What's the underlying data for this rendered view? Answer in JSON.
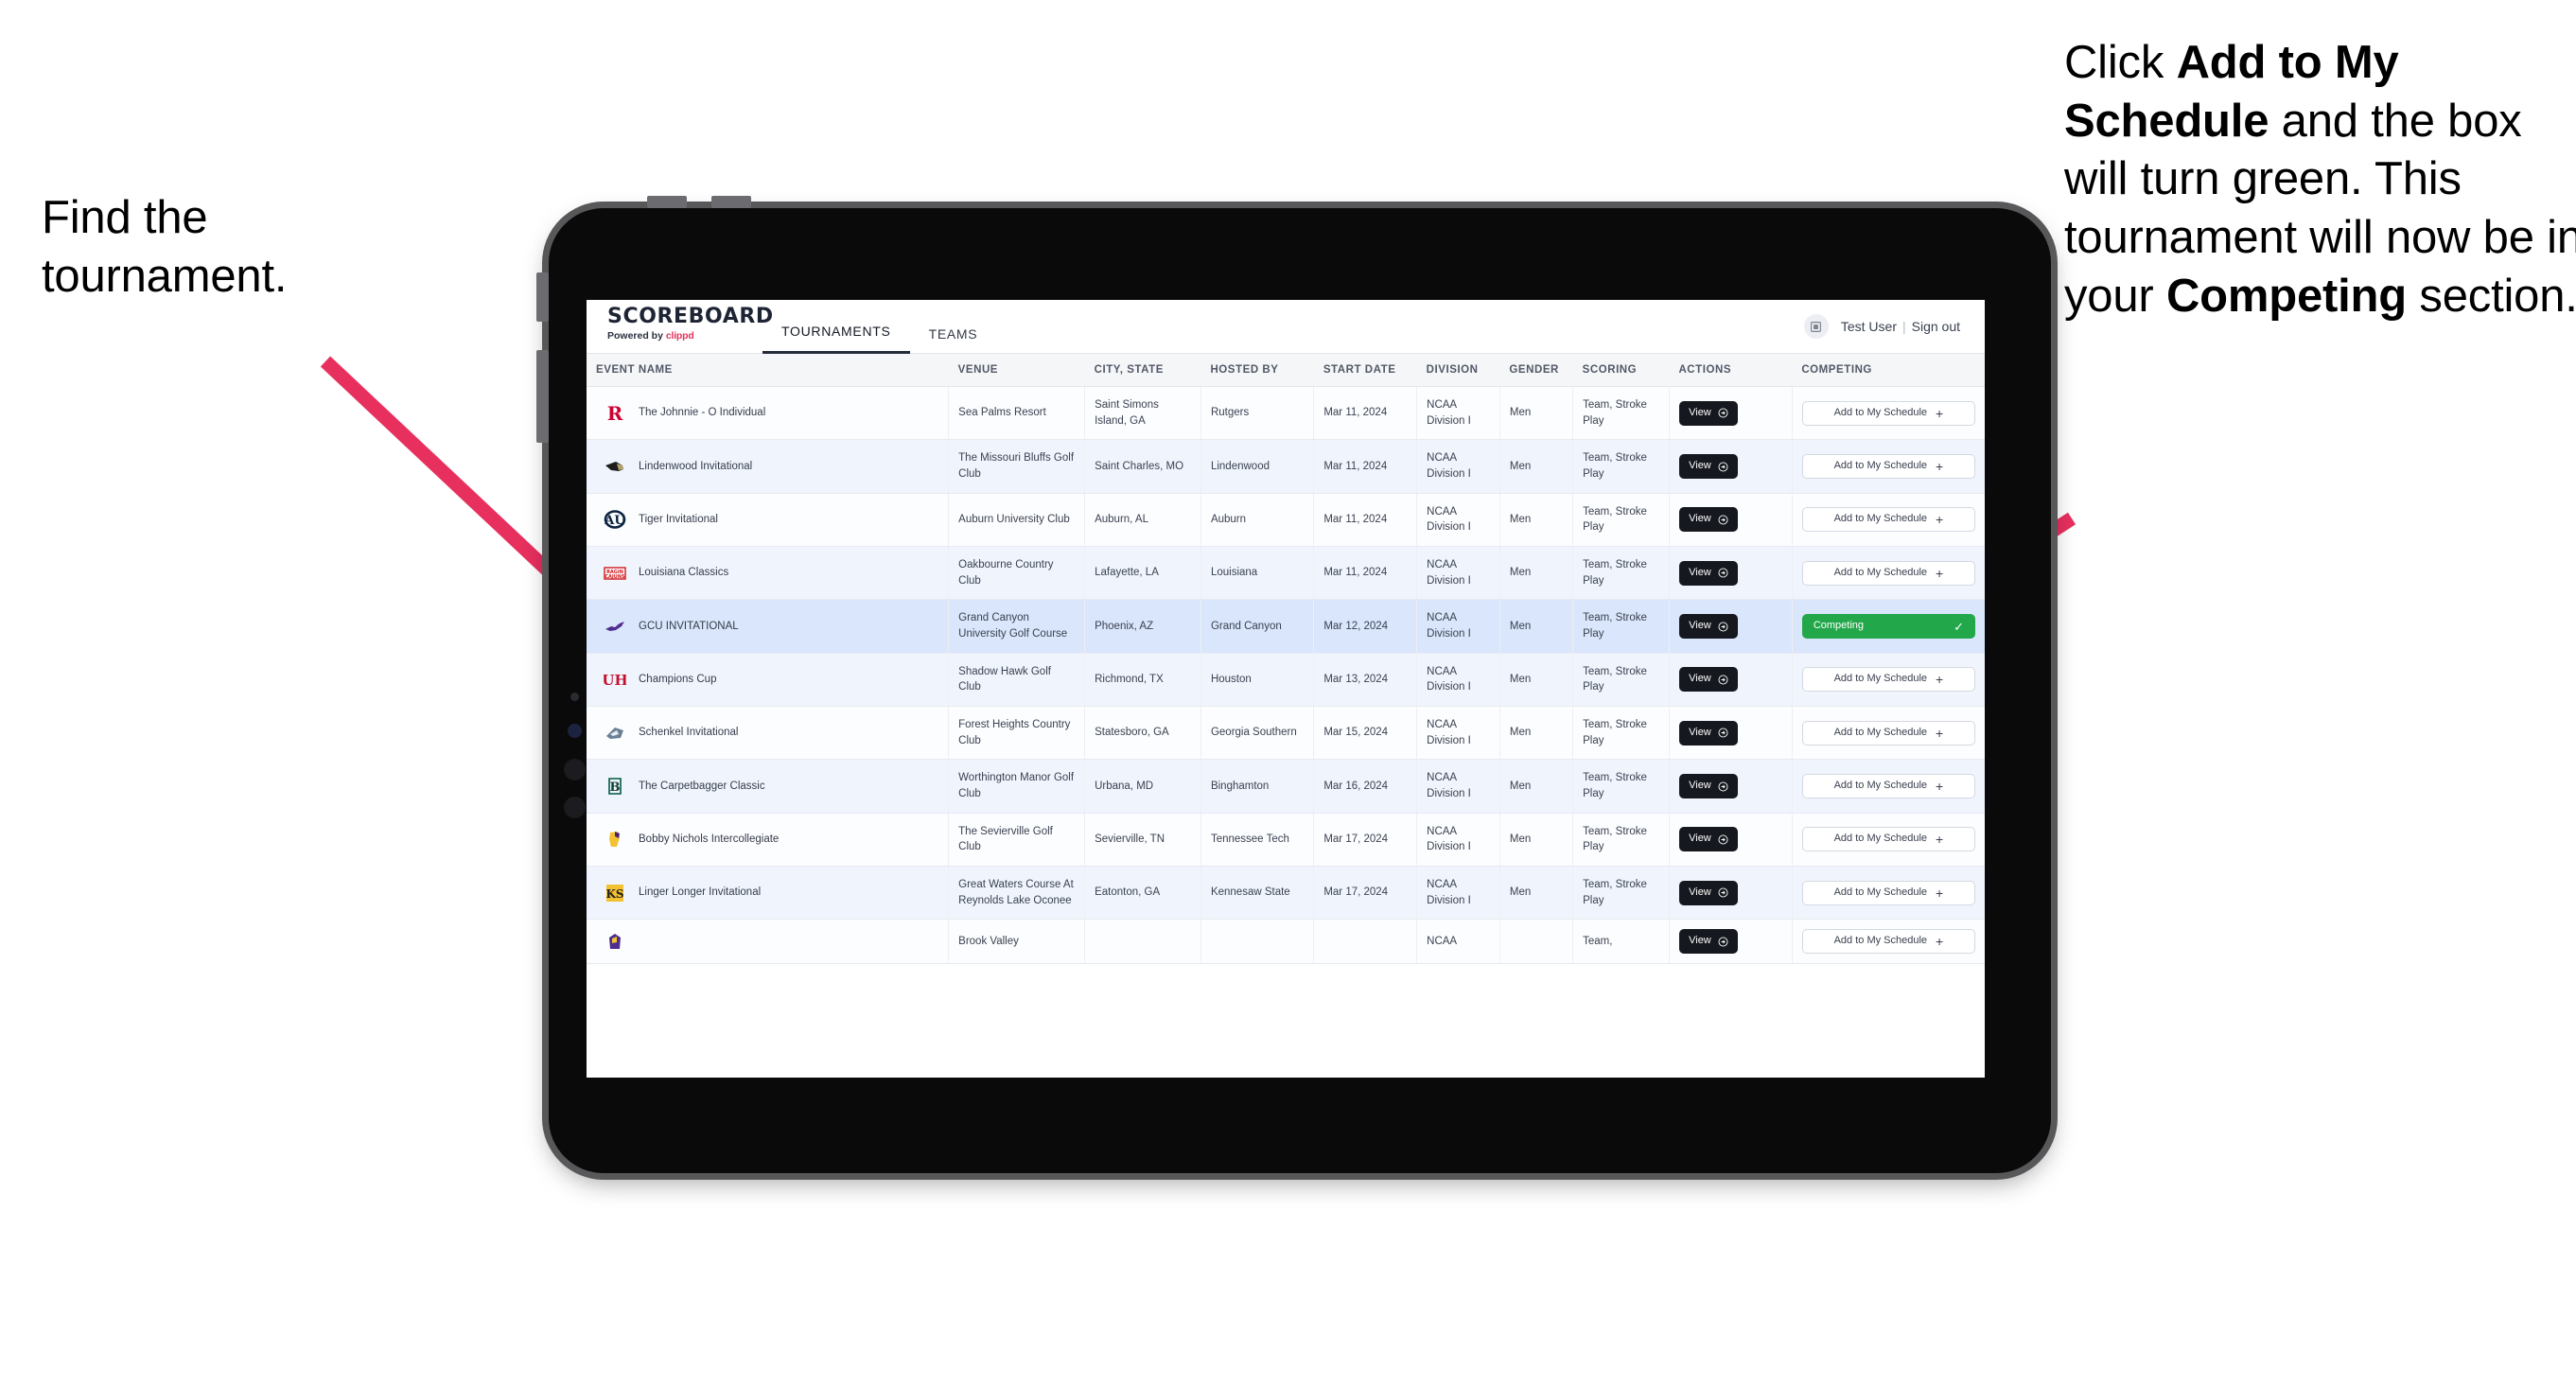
{
  "annotations": {
    "left": {
      "line1": "Find the",
      "line2": "tournament."
    },
    "right": {
      "p1": "Click ",
      "b1": "Add to My Schedule",
      "p2": " and the box will turn green. This tournament will now be in your ",
      "b2": "Competing",
      "p3": " section."
    },
    "arrow_color": "#e8305f"
  },
  "app": {
    "brand": {
      "name": "SCOREBOARD",
      "powered_prefix": "Powered by ",
      "powered_brand": "clippd"
    },
    "tabs": [
      {
        "label": "TOURNAMENTS",
        "active": true
      },
      {
        "label": "TEAMS",
        "active": false
      }
    ],
    "user": {
      "name": "Test User",
      "separator": "|",
      "signout": "Sign out"
    },
    "table": {
      "columns": [
        "EVENT NAME",
        "VENUE",
        "CITY, STATE",
        "HOSTED BY",
        "START DATE",
        "DIVISION",
        "GENDER",
        "SCORING",
        "ACTIONS",
        "COMPETING"
      ],
      "view_label": "View",
      "add_label": "Add to My Schedule",
      "competing_label": "Competing",
      "rows": [
        {
          "event": "The Johnnie - O Individual",
          "venue": "Sea Palms Resort",
          "city": "Saint Simons Island, GA",
          "host": "Rutgers",
          "date": "Mar 11, 2024",
          "division": "NCAA Division I",
          "gender": "Men",
          "scoring": "Team, Stroke Play",
          "competing": false,
          "logo": "rutgers-logo"
        },
        {
          "event": "Lindenwood Invitational",
          "venue": "The Missouri Bluffs Golf Club",
          "city": "Saint Charles, MO",
          "host": "Lindenwood",
          "date": "Mar 11, 2024",
          "division": "NCAA Division I",
          "gender": "Men",
          "scoring": "Team, Stroke Play",
          "competing": false,
          "logo": "lindenwood-lion-logo"
        },
        {
          "event": "Tiger Invitational",
          "venue": "Auburn University Club",
          "city": "Auburn, AL",
          "host": "Auburn",
          "date": "Mar 11, 2024",
          "division": "NCAA Division I",
          "gender": "Men",
          "scoring": "Team, Stroke Play",
          "competing": false,
          "logo": "auburn-logo"
        },
        {
          "event": "Louisiana Classics",
          "venue": "Oakbourne Country Club",
          "city": "Lafayette, LA",
          "host": "Louisiana",
          "date": "Mar 11, 2024",
          "division": "NCAA Division I",
          "gender": "Men",
          "scoring": "Team, Stroke Play",
          "competing": false,
          "logo": "ragin-cajuns-logo"
        },
        {
          "event": "GCU INVITATIONAL",
          "venue": "Grand Canyon University Golf Course",
          "city": "Phoenix, AZ",
          "host": "Grand Canyon",
          "date": "Mar 12, 2024",
          "division": "NCAA Division I",
          "gender": "Men",
          "scoring": "Team, Stroke Play",
          "competing": true,
          "logo": "gcu-lope-logo"
        },
        {
          "event": "Champions Cup",
          "venue": "Shadow Hawk Golf Club",
          "city": "Richmond, TX",
          "host": "Houston",
          "date": "Mar 13, 2024",
          "division": "NCAA Division I",
          "gender": "Men",
          "scoring": "Team, Stroke Play",
          "competing": false,
          "logo": "houston-logo"
        },
        {
          "event": "Schenkel Invitational",
          "venue": "Forest Heights Country Club",
          "city": "Statesboro, GA",
          "host": "Georgia Southern",
          "date": "Mar 15, 2024",
          "division": "NCAA Division I",
          "gender": "Men",
          "scoring": "Team, Stroke Play",
          "competing": false,
          "logo": "georgia-southern-logo"
        },
        {
          "event": "The Carpetbagger Classic",
          "venue": "Worthington Manor Golf Club",
          "city": "Urbana, MD",
          "host": "Binghamton",
          "date": "Mar 16, 2024",
          "division": "NCAA Division I",
          "gender": "Men",
          "scoring": "Team, Stroke Play",
          "competing": false,
          "logo": "binghamton-logo"
        },
        {
          "event": "Bobby Nichols Intercollegiate",
          "venue": "The Sevierville Golf Club",
          "city": "Sevierville, TN",
          "host": "Tennessee Tech",
          "date": "Mar 17, 2024",
          "division": "NCAA Division I",
          "gender": "Men",
          "scoring": "Team, Stroke Play",
          "competing": false,
          "logo": "tennessee-tech-logo"
        },
        {
          "event": "Linger Longer Invitational",
          "venue": "Great Waters Course At Reynolds Lake Oconee",
          "city": "Eatonton, GA",
          "host": "Kennesaw State",
          "date": "Mar 17, 2024",
          "division": "NCAA Division I",
          "gender": "Men",
          "scoring": "Team, Stroke Play",
          "competing": false,
          "logo": "kennesaw-state-logo"
        },
        {
          "event": "",
          "venue": "Brook Valley",
          "city": "",
          "host": "",
          "date": "",
          "division": "NCAA",
          "gender": "",
          "scoring": "Team,",
          "competing": false,
          "logo": "partial-row-logo"
        }
      ]
    }
  }
}
